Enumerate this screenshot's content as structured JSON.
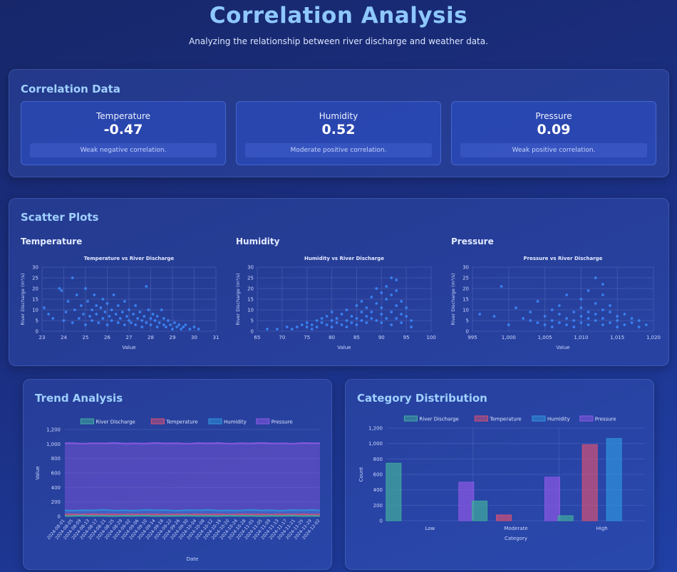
{
  "header": {
    "title": "Correlation Analysis",
    "subtitle": "Analyzing the relationship between river discharge and weather data."
  },
  "correlation": {
    "title": "Correlation Data",
    "items": [
      {
        "name": "Temperature",
        "value": "-0.47",
        "desc": "Weak negative correlation."
      },
      {
        "name": "Humidity",
        "value": "0.52",
        "desc": "Moderate positive correlation."
      },
      {
        "name": "Pressure",
        "value": "0.09",
        "desc": "Weak positive correlation."
      }
    ]
  },
  "scatter": {
    "title": "Scatter Plots",
    "labels": [
      "Temperature",
      "Humidity",
      "Pressure"
    ]
  },
  "trend": {
    "title": "Trend Analysis"
  },
  "category": {
    "title": "Category Distribution"
  },
  "colors": {
    "discharge": "#3fa59e",
    "temperature": "#c8507a",
    "humidity": "#2f8ed8",
    "pressure": "#8557e0",
    "scatter": "#3d8bff"
  },
  "chart_data": [
    {
      "type": "scatter",
      "title": "Temperature vs River Discharge",
      "xlabel": "Value",
      "ylabel": "River Discharge (m³/s)",
      "xlim": [
        23,
        31
      ],
      "ylim": [
        0,
        30
      ],
      "xticks": [
        "23",
        "24",
        "25",
        "26",
        "27",
        "28",
        "29",
        "30",
        "31"
      ],
      "yticks": [
        "0",
        "5",
        "10",
        "15",
        "20",
        "25",
        "30"
      ],
      "grid": true,
      "points": [
        [
          23.1,
          11
        ],
        [
          23.3,
          8
        ],
        [
          23.5,
          6
        ],
        [
          23.8,
          20
        ],
        [
          23.9,
          19
        ],
        [
          24.0,
          5
        ],
        [
          24.1,
          9
        ],
        [
          24.2,
          14
        ],
        [
          24.4,
          25
        ],
        [
          24.4,
          4
        ],
        [
          24.5,
          10
        ],
        [
          24.6,
          17
        ],
        [
          24.7,
          6
        ],
        [
          24.8,
          12
        ],
        [
          24.9,
          8
        ],
        [
          25.0,
          20
        ],
        [
          25.0,
          3
        ],
        [
          25.1,
          14
        ],
        [
          25.2,
          7
        ],
        [
          25.3,
          10
        ],
        [
          25.3,
          5
        ],
        [
          25.4,
          17
        ],
        [
          25.5,
          12
        ],
        [
          25.5,
          8
        ],
        [
          25.6,
          4
        ],
        [
          25.7,
          11
        ],
        [
          25.8,
          6
        ],
        [
          25.8,
          15
        ],
        [
          25.9,
          9
        ],
        [
          26.0,
          3
        ],
        [
          26.0,
          13
        ],
        [
          26.1,
          7
        ],
        [
          26.2,
          10
        ],
        [
          26.2,
          5
        ],
        [
          26.3,
          17
        ],
        [
          26.4,
          8
        ],
        [
          26.5,
          4
        ],
        [
          26.5,
          12
        ],
        [
          26.6,
          6
        ],
        [
          26.7,
          9
        ],
        [
          26.8,
          3
        ],
        [
          26.8,
          14
        ],
        [
          26.9,
          7
        ],
        [
          27.0,
          5
        ],
        [
          27.0,
          10
        ],
        [
          27.1,
          4
        ],
        [
          27.2,
          8
        ],
        [
          27.3,
          12
        ],
        [
          27.3,
          3
        ],
        [
          27.4,
          6
        ],
        [
          27.5,
          9
        ],
        [
          27.6,
          5
        ],
        [
          27.6,
          2
        ],
        [
          27.7,
          7
        ],
        [
          27.8,
          21
        ],
        [
          27.8,
          4
        ],
        [
          27.9,
          10
        ],
        [
          28.0,
          6
        ],
        [
          28.0,
          3
        ],
        [
          28.1,
          8
        ],
        [
          28.2,
          5
        ],
        [
          28.3,
          2
        ],
        [
          28.3,
          7
        ],
        [
          28.4,
          4
        ],
        [
          28.5,
          10
        ],
        [
          28.6,
          3
        ],
        [
          28.6,
          6
        ],
        [
          28.7,
          2
        ],
        [
          28.8,
          5
        ],
        [
          28.9,
          3
        ],
        [
          29.0,
          1
        ],
        [
          29.1,
          4
        ],
        [
          29.2,
          2
        ],
        [
          29.3,
          3
        ],
        [
          29.4,
          1
        ],
        [
          29.5,
          2
        ],
        [
          29.6,
          3
        ],
        [
          29.8,
          1
        ],
        [
          30.0,
          2
        ],
        [
          30.2,
          1
        ]
      ]
    },
    {
      "type": "scatter",
      "title": "Humidity vs River Discharge",
      "xlabel": "Value",
      "ylabel": "River Discharge (m³/s)",
      "xlim": [
        65,
        100
      ],
      "ylim": [
        0,
        30
      ],
      "xticks": [
        "65",
        "70",
        "75",
        "80",
        "85",
        "90",
        "95",
        "100"
      ],
      "yticks": [
        "0",
        "5",
        "10",
        "15",
        "20",
        "25",
        "30"
      ],
      "grid": true,
      "points": [
        [
          67,
          1
        ],
        [
          69,
          1
        ],
        [
          71,
          2
        ],
        [
          72,
          1
        ],
        [
          73,
          2
        ],
        [
          74,
          3
        ],
        [
          75,
          2
        ],
        [
          75,
          4
        ],
        [
          76,
          3
        ],
        [
          76,
          1
        ],
        [
          77,
          5
        ],
        [
          77,
          2
        ],
        [
          78,
          4
        ],
        [
          78,
          6
        ],
        [
          79,
          3
        ],
        [
          79,
          7
        ],
        [
          80,
          5
        ],
        [
          80,
          2
        ],
        [
          80,
          9
        ],
        [
          81,
          4
        ],
        [
          81,
          6
        ],
        [
          82,
          3
        ],
        [
          82,
          8
        ],
        [
          83,
          5
        ],
        [
          83,
          10
        ],
        [
          83,
          2
        ],
        [
          84,
          7
        ],
        [
          84,
          4
        ],
        [
          85,
          6
        ],
        [
          85,
          12
        ],
        [
          85,
          3
        ],
        [
          86,
          9
        ],
        [
          86,
          5
        ],
        [
          86,
          14
        ],
        [
          87,
          7
        ],
        [
          87,
          4
        ],
        [
          87,
          11
        ],
        [
          88,
          6
        ],
        [
          88,
          16
        ],
        [
          88,
          9
        ],
        [
          89,
          5
        ],
        [
          89,
          13
        ],
        [
          89,
          20
        ],
        [
          90,
          8
        ],
        [
          90,
          4
        ],
        [
          90,
          18
        ],
        [
          90,
          11
        ],
        [
          91,
          6
        ],
        [
          91,
          15
        ],
        [
          91,
          21
        ],
        [
          92,
          9
        ],
        [
          92,
          3
        ],
        [
          92,
          17
        ],
        [
          92,
          25
        ],
        [
          93,
          12
        ],
        [
          93,
          6
        ],
        [
          93,
          19
        ],
        [
          93,
          24
        ],
        [
          94,
          8
        ],
        [
          94,
          14
        ],
        [
          94,
          4
        ],
        [
          95,
          11
        ],
        [
          95,
          7
        ],
        [
          96,
          5
        ],
        [
          96,
          2
        ]
      ]
    },
    {
      "type": "scatter",
      "title": "Pressure vs River Discharge",
      "xlabel": "Value",
      "ylabel": "River Discharge (m³/s)",
      "xlim": [
        995,
        1020
      ],
      "ylim": [
        0,
        30
      ],
      "xticks": [
        "995",
        "1,000",
        "1,005",
        "1,010",
        "1,015",
        "1,020"
      ],
      "yticks": [
        "0",
        "5",
        "10",
        "15",
        "20",
        "25",
        "30"
      ],
      "grid": true,
      "points": [
        [
          996,
          8
        ],
        [
          998,
          7
        ],
        [
          999,
          21
        ],
        [
          1000,
          3
        ],
        [
          1001,
          11
        ],
        [
          1002,
          6
        ],
        [
          1003,
          5
        ],
        [
          1003,
          9
        ],
        [
          1004,
          4
        ],
        [
          1004,
          14
        ],
        [
          1005,
          7
        ],
        [
          1005,
          3
        ],
        [
          1006,
          10
        ],
        [
          1006,
          5
        ],
        [
          1006,
          2
        ],
        [
          1007,
          8
        ],
        [
          1007,
          12
        ],
        [
          1007,
          4
        ],
        [
          1008,
          6
        ],
        [
          1008,
          3
        ],
        [
          1008,
          17
        ],
        [
          1009,
          9
        ],
        [
          1009,
          5
        ],
        [
          1009,
          2
        ],
        [
          1010,
          11
        ],
        [
          1010,
          7
        ],
        [
          1010,
          4
        ],
        [
          1010,
          15
        ],
        [
          1011,
          6
        ],
        [
          1011,
          9
        ],
        [
          1011,
          3
        ],
        [
          1011,
          19
        ],
        [
          1012,
          25
        ],
        [
          1012,
          8
        ],
        [
          1012,
          5
        ],
        [
          1012,
          13
        ],
        [
          1013,
          17
        ],
        [
          1013,
          10
        ],
        [
          1013,
          6
        ],
        [
          1013,
          3
        ],
        [
          1013,
          22
        ],
        [
          1014,
          9
        ],
        [
          1014,
          4
        ],
        [
          1014,
          12
        ],
        [
          1015,
          7
        ],
        [
          1015,
          2
        ],
        [
          1015,
          5
        ],
        [
          1016,
          8
        ],
        [
          1016,
          3
        ],
        [
          1017,
          6
        ],
        [
          1017,
          4
        ],
        [
          1018,
          5
        ],
        [
          1018,
          2
        ],
        [
          1019,
          3
        ]
      ]
    },
    {
      "type": "area",
      "title": "",
      "xlabel": "Date",
      "ylabel": "Value",
      "ylim": [
        0,
        1200
      ],
      "yticks": [
        "0",
        "200",
        "400",
        "600",
        "800",
        "1,000",
        "1,200"
      ],
      "xticks": [
        "2024-08-01",
        "2024-08-05",
        "2024-08-09",
        "2024-08-13",
        "2024-08-17",
        "2024-08-21",
        "2024-08-25",
        "2024-08-29",
        "2024-09-02",
        "2024-09-06",
        "2024-09-10",
        "2024-09-14",
        "2024-09-18",
        "2024-09-22",
        "2024-09-26",
        "2024-09-30",
        "2024-10-04",
        "2024-10-08",
        "2024-10-12",
        "2024-10-16",
        "2024-10-20",
        "2024-10-24",
        "2024-10-28",
        "2024-11-01",
        "2024-11-05",
        "2024-11-09",
        "2024-11-13",
        "2024-11-17",
        "2024-11-21",
        "2024-11-25",
        "2024-11-29",
        "2024-12-02"
      ],
      "legend_position": "top",
      "series": [
        {
          "name": "River Discharge",
          "approx_level": 8
        },
        {
          "name": "Temperature",
          "approx_level": 27
        },
        {
          "name": "Humidity",
          "approx_level": 85
        },
        {
          "name": "Pressure",
          "approx_level": 1010
        }
      ]
    },
    {
      "type": "bar",
      "title": "",
      "xlabel": "Category",
      "ylabel": "Count",
      "ylim": [
        0,
        1200
      ],
      "yticks": [
        "0",
        "200",
        "400",
        "600",
        "800",
        "1,000",
        "1,200"
      ],
      "categories": [
        "Low",
        "Moderate",
        "High"
      ],
      "legend_position": "top",
      "series": [
        {
          "name": "River Discharge",
          "values": [
            745,
            255,
            65
          ]
        },
        {
          "name": "Temperature",
          "values": [
            0,
            75,
            985
          ]
        },
        {
          "name": "Humidity",
          "values": [
            0,
            0,
            1065
          ]
        },
        {
          "name": "Pressure",
          "values": [
            500,
            565,
            0
          ]
        }
      ]
    }
  ]
}
